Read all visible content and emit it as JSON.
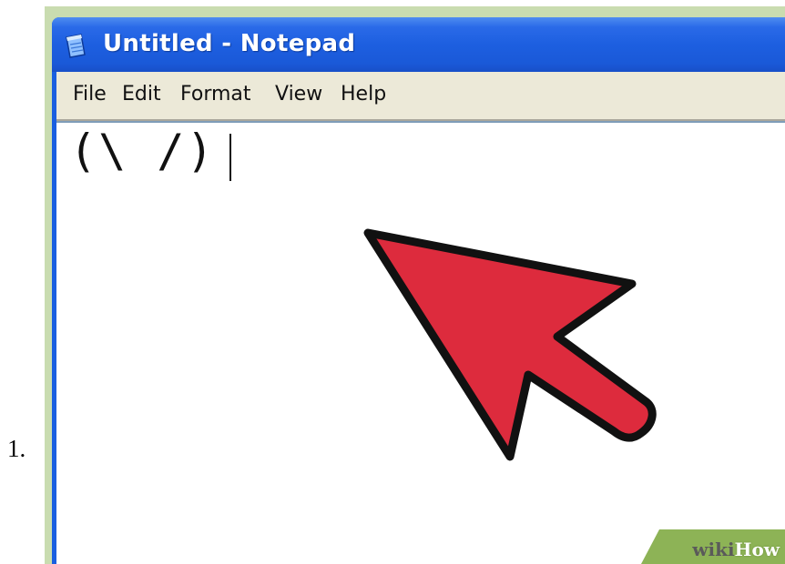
{
  "step": {
    "number": "1."
  },
  "window": {
    "title": "Untitled - Notepad",
    "icon": "notepad-icon",
    "titlebar_color": "#1d5fe0"
  },
  "menubar": {
    "items": [
      "File",
      "Edit",
      "Format",
      "View",
      "Help"
    ]
  },
  "editor": {
    "content": "(\\ /)"
  },
  "overlay": {
    "arrow": {
      "icon": "red-pointer-arrow",
      "fill": "#dd2b3d",
      "stroke": "#111111"
    }
  },
  "watermark": {
    "brand": "wikiHow",
    "part1": "wiki",
    "part2": "How"
  }
}
